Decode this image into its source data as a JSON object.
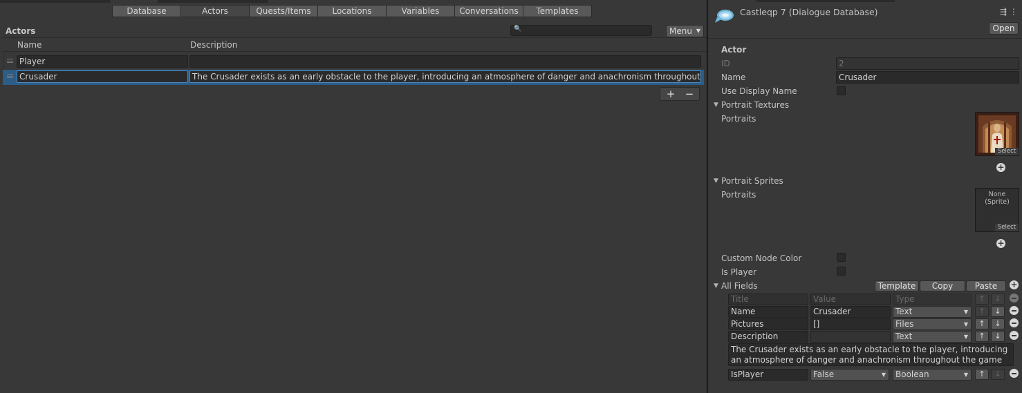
{
  "tabs": [
    "Database",
    "Actors",
    "Quests/Items",
    "Locations",
    "Variables",
    "Conversations",
    "Templates"
  ],
  "actors_header": "Actors",
  "search": {
    "placeholder": ""
  },
  "menu_label": "Menu",
  "table": {
    "columns": [
      "Name",
      "Description"
    ],
    "rows": [
      {
        "name": "Player",
        "description": ""
      },
      {
        "name": "Crusader",
        "description": "The Crusader exists as an early obstacle to the player, introducing an atmosphere of danger and anachronism throughout the game"
      }
    ],
    "add": "+",
    "remove": "−"
  },
  "inspector": {
    "title": "Castleqp 7 (Dialogue Database)",
    "open_label": "Open",
    "section": "Actor",
    "id_label": "ID",
    "id_value": "2",
    "name_label": "Name",
    "name_value": "Crusader",
    "use_display_name": "Use Display Name",
    "portrait_textures": "Portrait Textures",
    "portraits_label": "Portraits",
    "select_label": "Select",
    "portrait_sprites": "Portrait Sprites",
    "portraits_label2": "Portraits",
    "none_sprite": "None\n(Sprite)",
    "select_label2": "Select",
    "custom_node_color": "Custom Node Color",
    "is_player": "Is Player",
    "all_fields": "All Fields",
    "template_btn": "Template",
    "copy_btn": "Copy",
    "paste_btn": "Paste",
    "fields_header": {
      "title": "Title",
      "value": "Value",
      "type": "Type"
    },
    "fields": [
      {
        "title": "Name",
        "value": "Crusader",
        "type": "Text"
      },
      {
        "title": "Pictures",
        "value": "[]",
        "type": "Files"
      },
      {
        "title": "Description",
        "value": "",
        "type": "Text"
      },
      {
        "title": "IsPlayer",
        "value": "False",
        "type": "Boolean"
      }
    ],
    "description_text": "The Crusader exists as an early obstacle to the player, introducing an atmosphere of danger and anachronism throughout the game"
  }
}
